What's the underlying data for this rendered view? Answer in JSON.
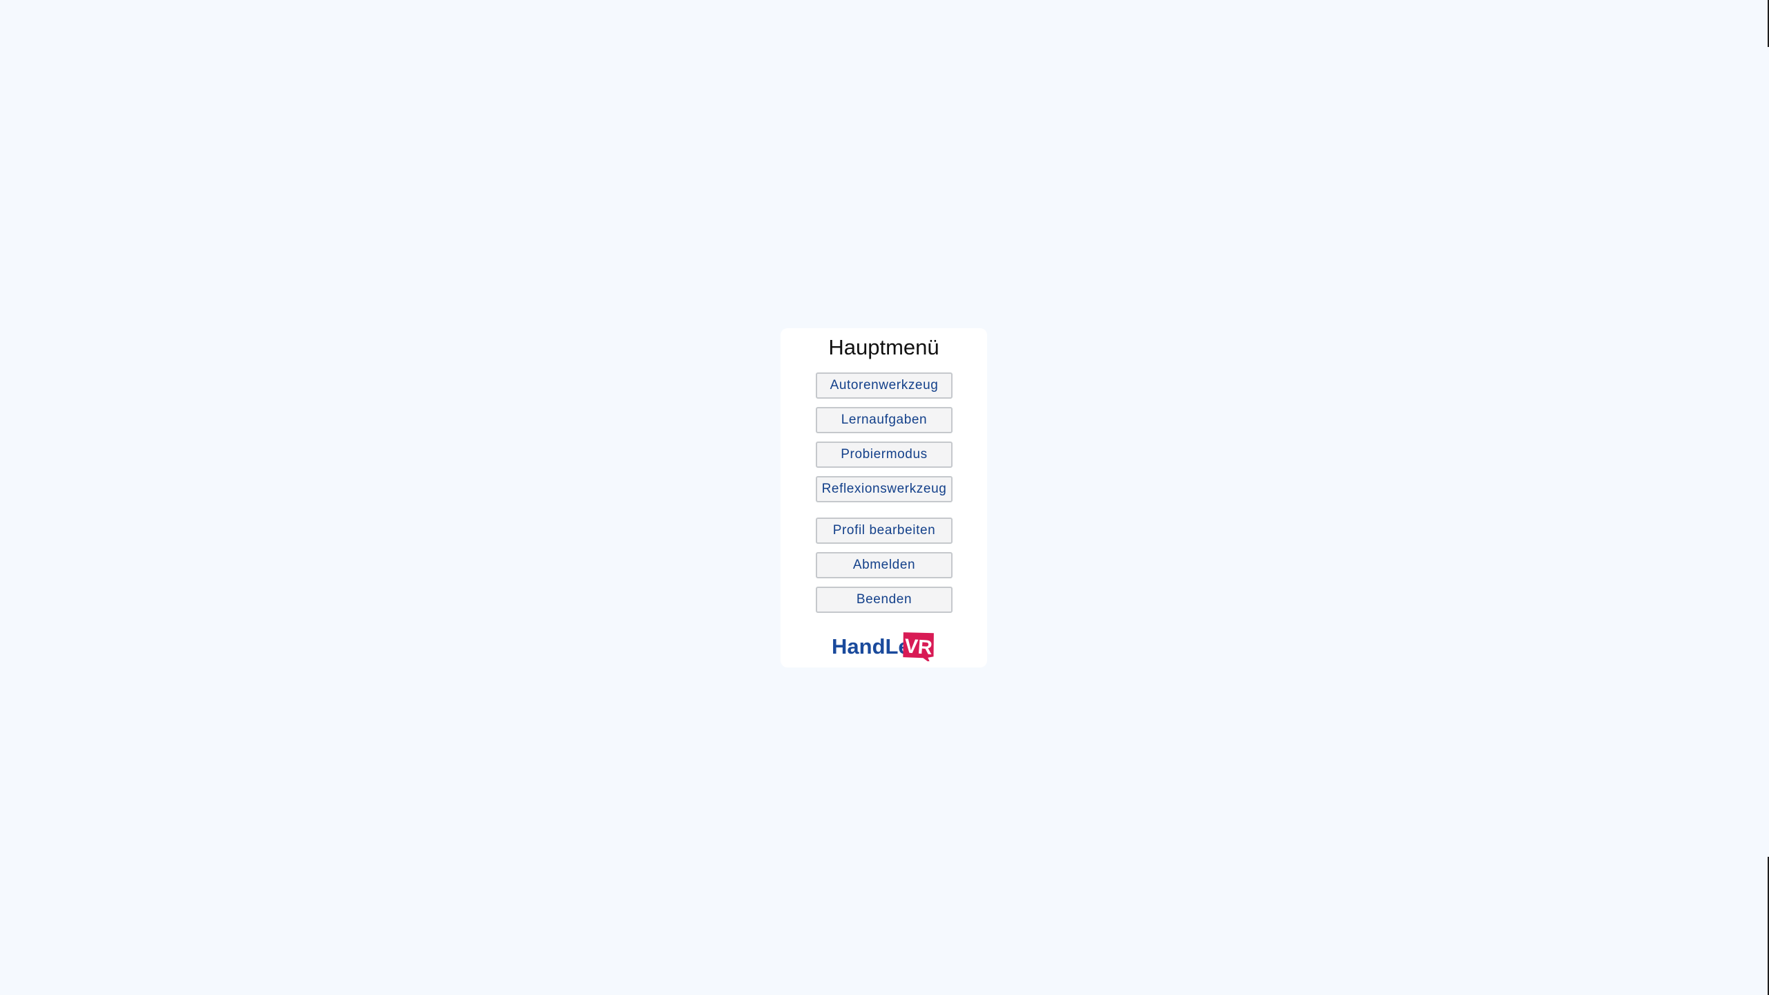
{
  "menu": {
    "title": "Hauptmenü",
    "buttons": [
      {
        "label": "Autorenwerkzeug"
      },
      {
        "label": "Lernaufgaben"
      },
      {
        "label": "Probiermodus"
      },
      {
        "label": "Reflexionswerkzeug"
      },
      {
        "label": "Profil bearbeiten"
      },
      {
        "label": "Abmelden"
      },
      {
        "label": "Beenden"
      }
    ]
  },
  "logo": {
    "text_part": "HandLe",
    "badge_part": "VR",
    "text_color": "#1a4a9c",
    "badge_color": "#d81b55"
  },
  "colors": {
    "background": "#f5f9fe",
    "card": "#ffffff",
    "button_text": "#13408a"
  }
}
